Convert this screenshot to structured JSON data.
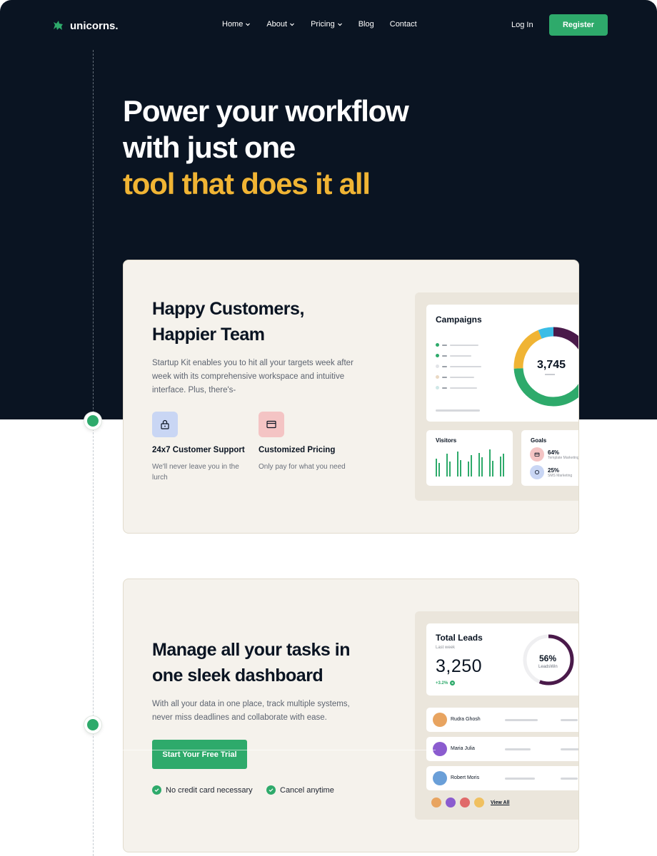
{
  "nav": {
    "logo": "unicorns.",
    "links": [
      {
        "label": "Home",
        "dropdown": true
      },
      {
        "label": "About",
        "dropdown": true
      },
      {
        "label": "Pricing",
        "dropdown": true
      },
      {
        "label": "Blog",
        "dropdown": false
      },
      {
        "label": "Contact",
        "dropdown": false
      }
    ],
    "login": "Log In",
    "register": "Register"
  },
  "hero": {
    "line1": "Power your workflow",
    "line2": "with just one",
    "line3_accent": "tool that does it all"
  },
  "section1": {
    "title_line1": "Happy Customers,",
    "title_line2": "Happier Team",
    "description": "Startup Kit enables you to hit all your targets week after week with its comprehensive workspace and intuitive interface. Plus, there's-",
    "features": [
      {
        "title": "24x7 Customer Support",
        "description": "We'll never leave you in the lurch",
        "icon": "lock-icon"
      },
      {
        "title": "Customized Pricing",
        "description": "Only pay for what you need",
        "icon": "card-icon"
      }
    ],
    "dashboard": {
      "campaigns_title": "Campaigns",
      "campaigns_value": "3,745",
      "visitors_title": "Visitors",
      "goals_title": "Goals",
      "goals": [
        {
          "pct": "64%",
          "label": "Template Marketing"
        },
        {
          "pct": "25%",
          "label": "SMS Marketing"
        }
      ]
    }
  },
  "section2": {
    "title_line1": "Manage all your tasks in",
    "title_line2": "one sleek dashboard",
    "description": "With all your data in one place, track multiple systems, never miss deadlines and collaborate with ease.",
    "cta": "Start Your Free Trial",
    "checks": [
      "No credit card necessary",
      "Cancel anytime"
    ],
    "dashboard": {
      "leads_title": "Total Leads",
      "leads_sub": "Last week",
      "leads_value": "3,250",
      "leads_change": "+3.2%",
      "ring_pct": "56%",
      "ring_label": "LeadsWin",
      "people": [
        "Rudra Ghosh",
        "Maria Julia",
        "Robert Moris"
      ],
      "view_all": "View All"
    }
  },
  "colors": {
    "hero_bg": "#0a1422",
    "accent_yellow": "#f0b434",
    "brand_green": "#2eaa6b",
    "card_bg": "#f5f2ec"
  }
}
